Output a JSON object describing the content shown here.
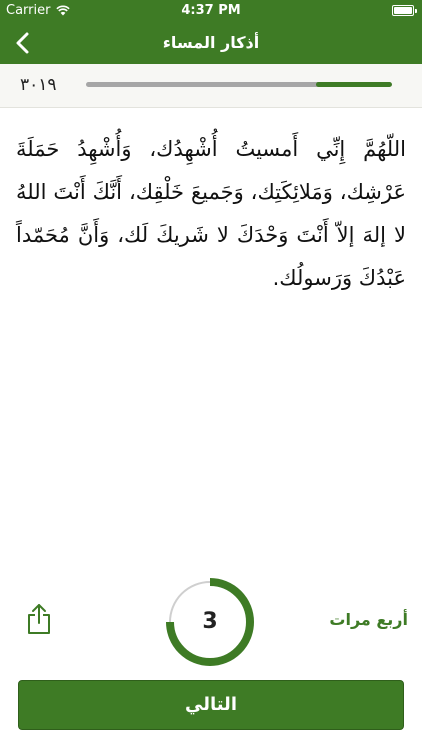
{
  "status_bar": {
    "carrier": "Carrier",
    "time": "4:37 PM"
  },
  "nav": {
    "title": "أذكار المساء",
    "back_icon": "chevron-left-icon"
  },
  "progress": {
    "counter": "٣٠١٩",
    "fraction_complete": 0.25
  },
  "dua": {
    "text": "اللّهُمَّ إِنِّي أَمسيتُ أُشْهِدُك، وَأُشْهِدُ حَمَلَةَ عَرْشِك، وَمَلائِكَتِك، وَجَميعَ خَلْقِك، أَنَّكَ أَنْتَ اللهُ لا إلهَ إلاّ أَنْتَ وَحْدَكَ لا شَريكَ لَك، وَأَنَّ مُحَمّداً عَبْدُكَ وَرَسولُك."
  },
  "counter": {
    "remaining": "3",
    "total": 4,
    "done": 1,
    "repeat_label": "أربع مرات"
  },
  "actions": {
    "next_label": "التالي",
    "share_icon": "share-icon"
  },
  "colors": {
    "accent": "#3e7b25",
    "track": "#a6a6a6",
    "ring_track": "#cfcfcf"
  }
}
